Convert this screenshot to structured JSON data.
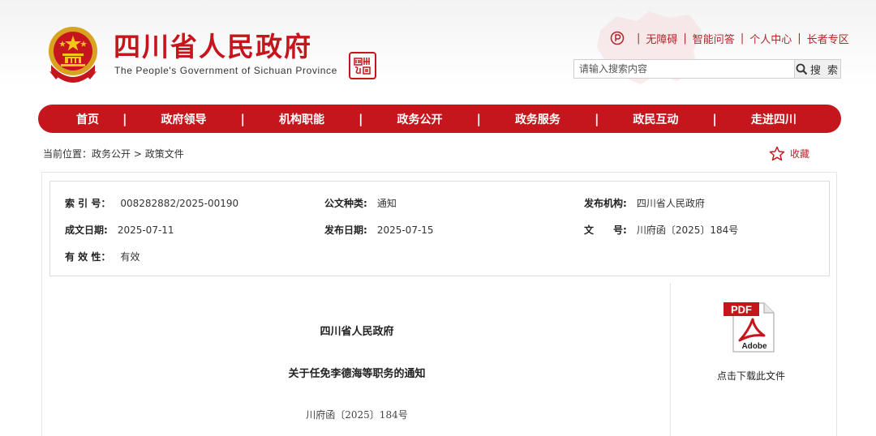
{
  "header": {
    "site_name_cn": "四川省人民政府",
    "site_name_en": "The People's Government of Sichuan Province",
    "seal_text": "四川",
    "top_links": [
      "无障碍",
      "智能问答",
      "个人中心",
      "长者专区"
    ]
  },
  "search": {
    "placeholder": "请输入搜索内容",
    "button_label": "搜 索"
  },
  "nav": {
    "items": [
      "首页",
      "政府领导",
      "机构职能",
      "政务公开",
      "政务服务",
      "政民互动",
      "走进四川"
    ]
  },
  "breadcrumb": {
    "prefix": "当前位置：",
    "path": "政务公开 > 政策文件"
  },
  "favorite": {
    "label": "收藏"
  },
  "meta": {
    "index_label": "索 引 号：",
    "index_value": "008282882/2025-00190",
    "type_label": "公文种类:",
    "type_value": "通知",
    "issuer_label": "发布机构:",
    "issuer_value": "四川省人民政府",
    "created_label": "成文日期:",
    "created_value": "2025-07-11",
    "published_label": "发布日期:",
    "published_value": "2025-07-15",
    "docno_label": "文　　号:",
    "docno_value": "川府函〔2025〕184号",
    "validity_label": "有 效 性：",
    "validity_value": "有效"
  },
  "document": {
    "issuer": "四川省人民政府",
    "title": "关于任免李德海等职务的通知",
    "number": "川府函〔2025〕184号"
  },
  "download": {
    "pdf_badge": "PDF",
    "adobe_text": "Adobe",
    "label": "点击下载此文件"
  },
  "colors": {
    "brand_red": "#c4161c",
    "link_red": "#b4262a"
  }
}
